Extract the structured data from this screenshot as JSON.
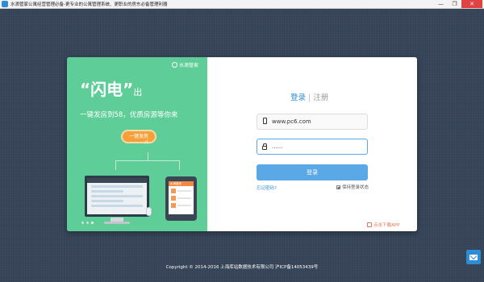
{
  "window": {
    "title": "水滴管家公寓经营管理必备-更专业的公寓管理系统、更职业的房东必备管理利器",
    "minimize": "—",
    "restore": "❐",
    "close": "✕"
  },
  "promo": {
    "brand": "水滴管家",
    "headline": "“闪电”",
    "headline_suffix": "出",
    "tagline": "一键发房到58，优质房源等你来",
    "cta": "一键发房",
    "tablet_header": "水滴管家"
  },
  "login": {
    "tab_login": "登录",
    "tab_separator": "|",
    "tab_register": "注册",
    "phone_value": "www.pc6.com",
    "password_value": "......",
    "login_button": "登录",
    "forgot_password": "忘记密码?",
    "remember_label": "保持登录状态",
    "remember_checked": true,
    "download_app": "点击下载APP"
  },
  "footer": {
    "copyright": "Copyright © 2014-2016 上海库站数据技术有限公司 沪ICP备14053439号"
  },
  "colors": {
    "background": "#3c4a5e",
    "promo_green": "#5fcd97",
    "accent_blue": "#5aa8e6",
    "cta_orange": "#f4a13b",
    "download_red": "#e8734f"
  },
  "icons": [
    "app-icon",
    "minimize-icon",
    "restore-icon",
    "close-icon",
    "brand-logo-icon",
    "phone-icon",
    "lock-icon",
    "checkbox-icon",
    "download-icon",
    "mail-icon"
  ]
}
